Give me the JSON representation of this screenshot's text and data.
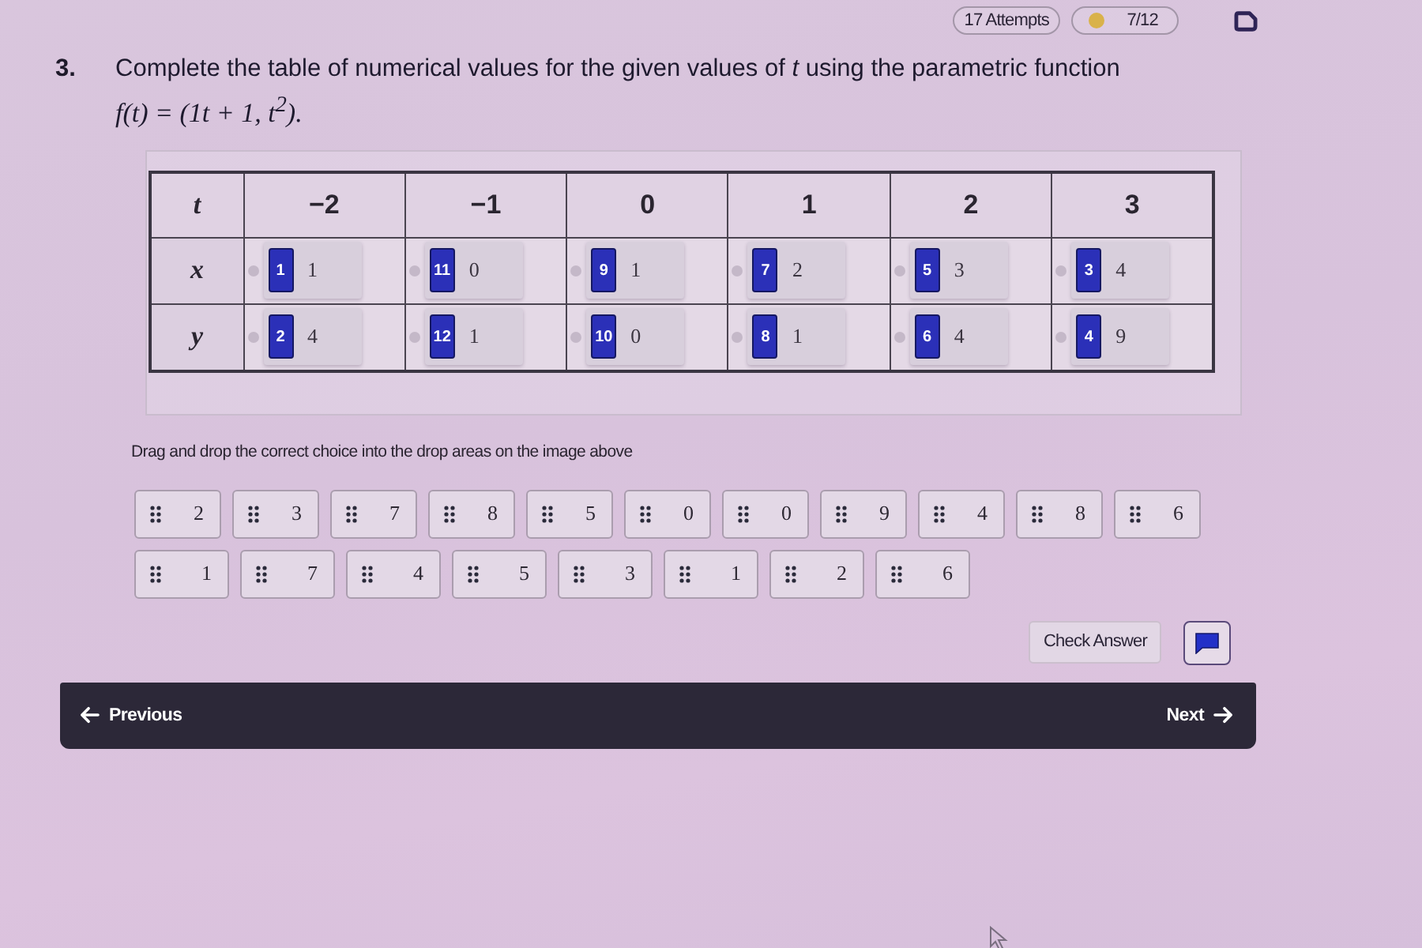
{
  "status": {
    "attempts": "17 Attempts",
    "score": "7/12"
  },
  "question": {
    "number": "3.",
    "text": "Complete the table of numerical values for the given values of *t* using the parametric function",
    "formula": "f(t) = (1t + 1, t$^{2}$)."
  },
  "table": {
    "header": "t",
    "columns": [
      "−2",
      "−1",
      "0",
      "1",
      "2",
      "3"
    ],
    "rows": [
      {
        "label": "x",
        "cells": [
          {
            "badge": "1",
            "value": "1"
          },
          {
            "badge": "11",
            "value": "0"
          },
          {
            "badge": "9",
            "value": "1"
          },
          {
            "badge": "7",
            "value": "2"
          },
          {
            "badge": "5",
            "value": "3"
          },
          {
            "badge": "3",
            "value": "4"
          }
        ]
      },
      {
        "label": "y",
        "cells": [
          {
            "badge": "2",
            "value": "4"
          },
          {
            "badge": "12",
            "value": "1"
          },
          {
            "badge": "10",
            "value": "0"
          },
          {
            "badge": "8",
            "value": "1"
          },
          {
            "badge": "6",
            "value": "4"
          },
          {
            "badge": "4",
            "value": "9"
          }
        ]
      }
    ]
  },
  "instruction": "Drag and drop the correct choice into the drop areas on the image above",
  "choices": [
    [
      "2",
      "3",
      "7",
      "8",
      "5",
      "0",
      "0",
      "9",
      "4",
      "8",
      "6"
    ],
    [
      "1",
      "7",
      "4",
      "5",
      "3",
      "1",
      "2",
      "6"
    ]
  ],
  "actions": {
    "check": "Check Answer"
  },
  "nav": {
    "previous": "Previous",
    "next": "Next"
  }
}
